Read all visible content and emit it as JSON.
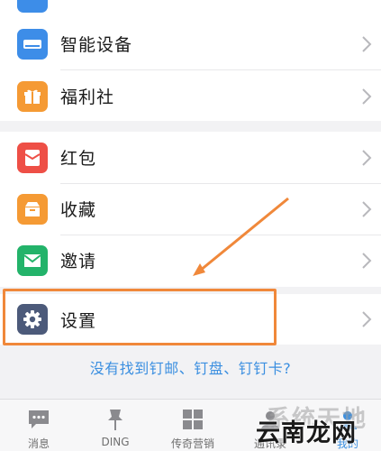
{
  "menu_groups": [
    {
      "items": [
        {
          "label": "智能设备",
          "icon": "smart-device-icon",
          "color": "#3d8de8"
        },
        {
          "label": "福利社",
          "icon": "gift-icon",
          "color": "#f59a34"
        }
      ]
    },
    {
      "items": [
        {
          "label": "红包",
          "icon": "red-envelope-icon",
          "color": "#ee4f46"
        },
        {
          "label": "收藏",
          "icon": "favorites-box-icon",
          "color": "#f59a34"
        },
        {
          "label": "邀请",
          "icon": "invite-mail-icon",
          "color": "#23b36a"
        }
      ]
    },
    {
      "items": [
        {
          "label": "设置",
          "icon": "gear-icon",
          "color": "#4c5a7a"
        }
      ]
    }
  ],
  "help_link": "没有找到钉邮、钉盘、钉钉卡?",
  "tabbar": {
    "tabs": [
      {
        "label": "消息",
        "icon": "message-icon"
      },
      {
        "label": "DING",
        "icon": "pin-icon"
      },
      {
        "label": "传奇营销",
        "icon": "grid-icon"
      },
      {
        "label": "通讯录",
        "icon": "contacts-icon"
      },
      {
        "label": "我的",
        "icon": "profile-icon"
      }
    ],
    "active": "我的"
  },
  "watermark": {
    "faint_text": "系统天地",
    "main_text": "云南龙网"
  },
  "annotation_color": "#f0883a",
  "accent_color": "#3b8fe0"
}
